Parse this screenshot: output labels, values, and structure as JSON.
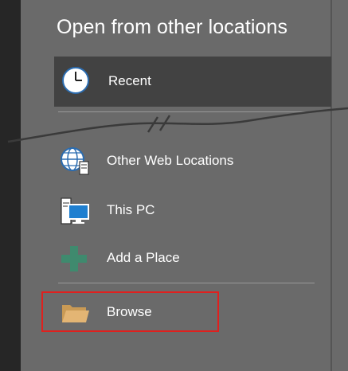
{
  "title": "Open from other locations",
  "recent": {
    "label": "Recent",
    "icon": "clock-icon"
  },
  "locations": [
    {
      "label": "Other Web Locations",
      "icon": "globe-server-icon"
    },
    {
      "label": "This PC",
      "icon": "computer-icon"
    },
    {
      "label": "Add a Place",
      "icon": "plus-icon"
    },
    {
      "label": "Browse",
      "icon": "folder-icon"
    }
  ],
  "colors": {
    "background": "#6a6a6a",
    "selected": "#424242",
    "highlight_border": "#e0201e",
    "plus_green": "#3f8a6e",
    "folder": "#e3b574"
  }
}
